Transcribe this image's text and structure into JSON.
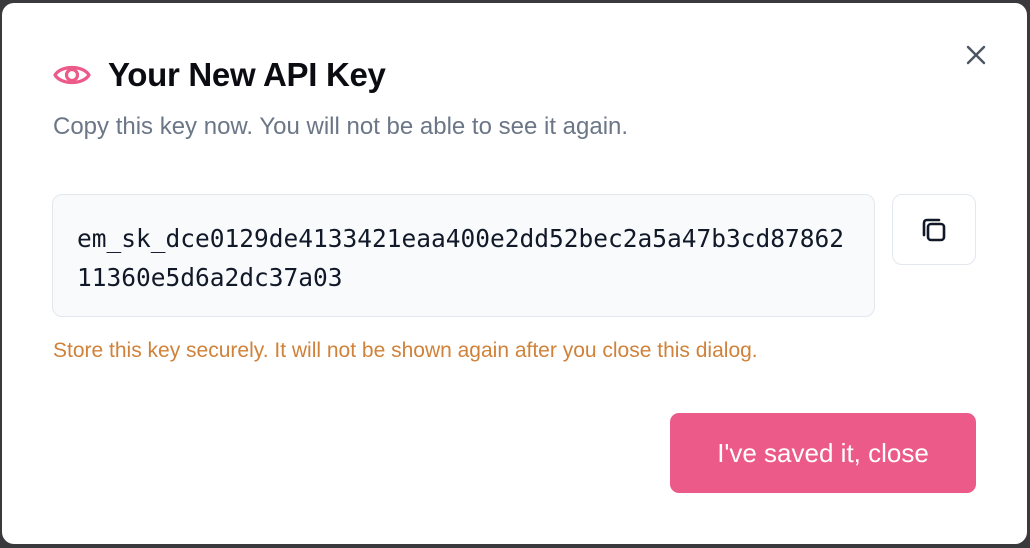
{
  "dialog": {
    "title": "Your New API Key",
    "subtitle": "Copy this key now. You will not be able to see it again.",
    "api_key": "em_sk_dce0129de4133421eaa400e2dd52bec2a5a47b3cd8786211360e5d6a2dc37a03",
    "warning": "Store this key securely. It will not be shown again after you close this dialog.",
    "close_button_label": "I've saved it, close",
    "icons": {
      "title": "eye-icon",
      "copy": "copy-icon",
      "close": "close-icon"
    },
    "colors": {
      "accent": "#ec5a8a",
      "warning": "#d0823a",
      "subtitle": "#6b7686"
    }
  }
}
